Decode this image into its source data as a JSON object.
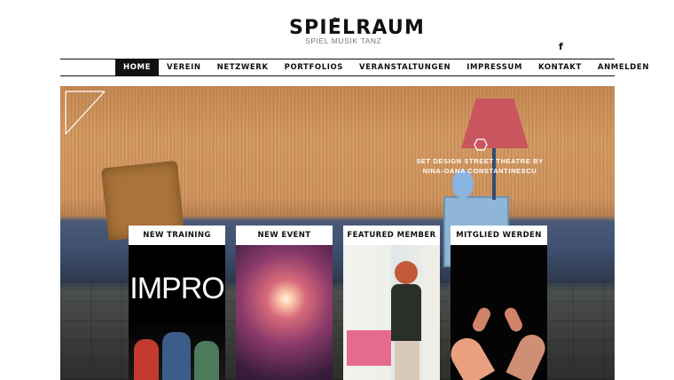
{
  "header": {
    "logo_mark": "~",
    "logo": "SPIELRAUM",
    "tagline": "SPIEL MUSIK TANZ",
    "facebook_label": "f"
  },
  "nav": {
    "items": [
      {
        "label": "HOME",
        "active": true
      },
      {
        "label": "VEREIN"
      },
      {
        "label": "NETZWERK"
      },
      {
        "label": "PORTFOLIOS"
      },
      {
        "label": "VERANSTALTUNGEN"
      },
      {
        "label": "IMPRESSUM"
      },
      {
        "label": "KONTAKT"
      },
      {
        "label": "ANMELDEN"
      }
    ]
  },
  "hero": {
    "caption_line1": "SET DESIGN STREET THEATRE BY",
    "caption_line2": "NINA-OANA CONSTANTINESCU"
  },
  "cards": [
    {
      "title": "NEW TRAINING",
      "image_text": "IMPRO"
    },
    {
      "title": "NEW EVENT"
    },
    {
      "title": "FEATURED MEMBER"
    },
    {
      "title": "MITGLIED WERDEN"
    }
  ],
  "colors": {
    "nav_active_bg": "#111111",
    "text": "#111111",
    "tagline": "#777777"
  }
}
